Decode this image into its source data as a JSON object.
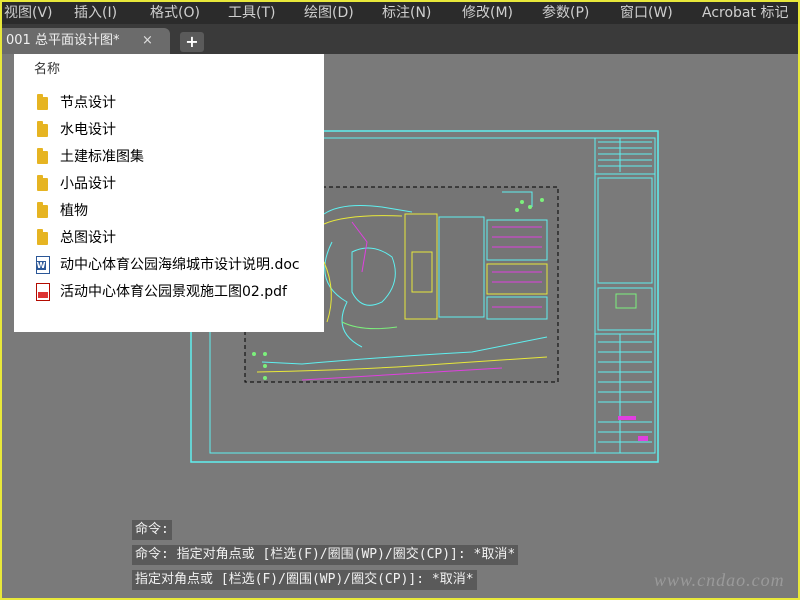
{
  "menu": [
    "视图(V)",
    "插入(I)",
    "格式(O)",
    "工具(T)",
    "绘图(D)",
    "标注(N)",
    "修改(M)",
    "参数(P)",
    "窗口(W)",
    "Acrobat 标记"
  ],
  "tabs": {
    "active_label": "001 总平面设计图*",
    "close_glyph": "×",
    "add_glyph": "+"
  },
  "file_panel": {
    "column_header": "名称",
    "items": [
      {
        "name": "节点设计",
        "type": "folder"
      },
      {
        "name": "水电设计",
        "type": "folder"
      },
      {
        "name": "土建标准图集",
        "type": "folder"
      },
      {
        "name": "小品设计",
        "type": "folder"
      },
      {
        "name": "植物",
        "type": "folder"
      },
      {
        "name": "总图设计",
        "type": "folder"
      },
      {
        "name": "动中心体育公园海绵城市设计说明.doc",
        "type": "doc"
      },
      {
        "name": "活动中心体育公园景观施工图02.pdf",
        "type": "pdf"
      }
    ]
  },
  "command_lines": [
    "命令:",
    "命令: 指定对角点或 [栏选(F)/圈围(WP)/圈交(CP)]: *取消*",
    "指定对角点或 [栏选(F)/圈围(WP)/圈交(CP)]: *取消*"
  ],
  "watermark": "www.cndao.com",
  "colors": {
    "cad_cyan": "#5ff0f0",
    "cad_yellow": "#e8e83a",
    "canvas_bg": "#7a7a7a"
  }
}
